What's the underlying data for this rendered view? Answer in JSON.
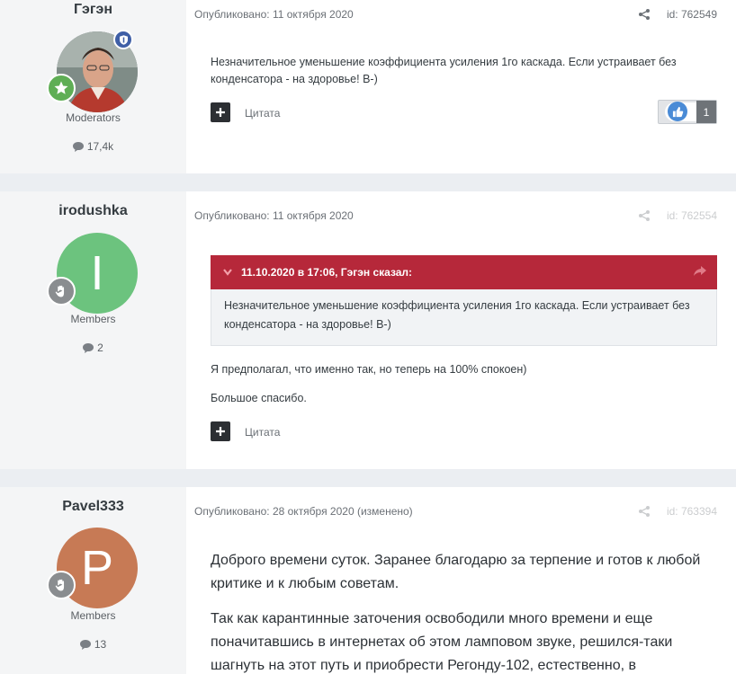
{
  "posts": [
    {
      "username": "Гэгэн",
      "role": "Moderators",
      "count": "17,4k",
      "published": "Опубликовано: 11 октября 2020",
      "post_id": "id: 762549",
      "text": "Незначительное уменьшение  коэффициента  усиления 1го каскада. Если устраивает без конденсатора - на здоровье! В-)",
      "quote_label": "Цитата",
      "reaction_count": "1",
      "colors": {
        "moderator_badge": "#3f5fa6",
        "group_badge": "#5fae55"
      }
    },
    {
      "username": "irodushka",
      "avatar_letter": "I",
      "role": "Members",
      "count": "2",
      "published": "Опубликовано: 11 октября 2020",
      "post_id": "id: 762554",
      "quote": {
        "header": "11.10.2020 в 17:06, Гэгэн сказал:",
        "text": "Незначительное уменьшение  коэффициента  усиления 1го каскада. Если устраивает без конденсатора - на здоровье! В-)"
      },
      "paragraphs": [
        "Я предполагал, что именно так, но теперь на 100% спокоен)",
        "Большое спасибо."
      ],
      "quote_label": "Цитата",
      "colors": {
        "avatar": "#6cc37e"
      }
    },
    {
      "username": "Pavel333",
      "avatar_letter": "P",
      "role": "Members",
      "count": "13",
      "published": "Опубликовано: 28 октября 2020 (изменено)",
      "post_id": "id: 763394",
      "paragraphs": [
        "Доброго времени суток. Заранее благодарю за терпение и готов к любой критике и к любым советам.",
        "Так как карантинные заточения освободили много времени и еще поначитавшись в интернетах об этом ламповом звуке, решился-таки шагнуть на этот путь и приобрести Регонду-102, естественно, в"
      ],
      "colors": {
        "avatar": "#c77a55"
      }
    }
  ],
  "icons": {
    "share": "share-icon",
    "comment": "comment-icon",
    "like": "like-icon",
    "plus": "plus-icon",
    "chevron": "chevron-down-icon",
    "go_to_quote": "arrow-right-icon",
    "star": "star-icon",
    "shield": "shield-icon",
    "hand": "hand-icon"
  }
}
